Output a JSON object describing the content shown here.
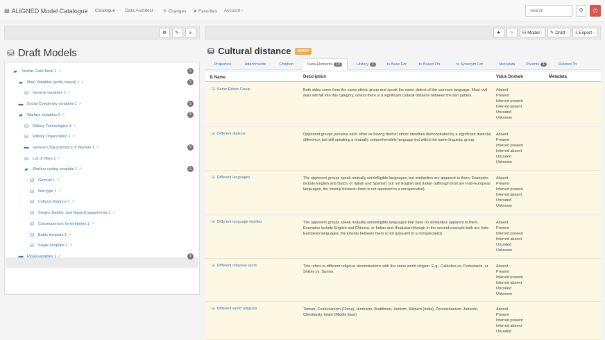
{
  "navbar": {
    "brand": "ALIGNED Model Catalogue",
    "links": [
      "Catalogue -",
      "Data Architect -",
      "Changes",
      "Favorites",
      "Account -"
    ],
    "search_placeholder": "Search"
  },
  "left": {
    "toolbar": {
      "settings": "⚙",
      "edit": "✎-",
      "download": "⤓-"
    },
    "title": "Draft Models",
    "tree": [
      {
        "label": "Seshat Code Book 1",
        "icon": "folder-open-icon",
        "badge": "5"
      },
      {
        "label": "Main Variables (polity-based) 1",
        "icon": "folder-open-icon",
        "badge": "5"
      },
      {
        "label": "General variables 1",
        "icon": "cubes-icon",
        "badge": ""
      },
      {
        "label": "Social Complexity variables 1",
        "icon": "folder-icon",
        "badge": "5"
      },
      {
        "label": "Warfare variables 1",
        "icon": "folder-open-icon",
        "badge": "5"
      },
      {
        "label": "Military Technologies 1",
        "icon": "cubes-icon",
        "badge": ""
      },
      {
        "label": "Military Organization 1",
        "icon": "cubes-icon",
        "badge": ""
      },
      {
        "label": "General Characteristics of Warfare 1",
        "icon": "folder-icon",
        "badge": "5"
      },
      {
        "label": "List of Wars 1",
        "icon": "cubes-icon",
        "badge": ""
      },
      {
        "label": "Warfare coding template 1",
        "icon": "folder-open-icon",
        "badge": "5"
      },
      {
        "label": "General 1",
        "icon": "cubes-icon",
        "badge": ""
      },
      {
        "label": "War type 1",
        "icon": "cubes-icon",
        "badge": ""
      },
      {
        "label": "Cultural distance 1",
        "icon": "cubes-icon",
        "badge": ""
      },
      {
        "label": "Sieges, Battles, and Naval Engagements 1",
        "icon": "cubes-icon",
        "badge": ""
      },
      {
        "label": "Consequences for territories 1",
        "icon": "cubes-icon",
        "badge": ""
      },
      {
        "label": "Battle template 1",
        "icon": "cubes-icon",
        "badge": ""
      },
      {
        "label": "Siege Template 1",
        "icon": "cubes-icon",
        "badge": ""
      },
      {
        "label": "Ritual variables 1",
        "icon": "folder-icon",
        "badge": "5"
      }
    ]
  },
  "right": {
    "toolbar": {
      "star": "★",
      "link": "☞",
      "model": "Model -",
      "draft": "Draft -",
      "export": "Export -"
    },
    "title": "Cultural distance",
    "status": "DRAFT",
    "tabs": [
      {
        "label": "Properties",
        "count": ""
      },
      {
        "label": "Attachments",
        "count": ""
      },
      {
        "label": "Children",
        "count": ""
      },
      {
        "label": "Data Elements",
        "count": "10"
      },
      {
        "label": "History",
        "count": "1"
      },
      {
        "label": "Is Base For",
        "count": ""
      },
      {
        "label": "Is Based On",
        "count": ""
      },
      {
        "label": "Is Synonym For",
        "count": ""
      },
      {
        "label": "Metadata",
        "count": ""
      },
      {
        "label": "Parents",
        "count": "1"
      },
      {
        "label": "Related To",
        "count": ""
      }
    ],
    "columns": {
      "name": "Name",
      "description": "Description",
      "value_domain": "Value Domain",
      "metadata": "Metadata"
    },
    "rows": [
      {
        "name": "Same Ethnic Group",
        "description": "Both sides come from the same ethnic group and speak the same dialect of the common language. Most civil wars will fall into this category, unless there is a significant cultural distance between the two parties.",
        "values": [
          "Absent",
          "Present",
          "Inferred present",
          "Inferred absent",
          "Uncoded",
          "Unknown"
        ]
      },
      {
        "name": "Different dialects",
        "description": "Opponent groups perceive each other as having distinct ethnic identities demonstrated by a significant dialectal difference, but still speaking a mutually comprehensible language but within the same linguistic group.",
        "values": [
          "Absent",
          "Present",
          "Inferred present",
          "Inferred absent",
          "Uncoded",
          "Unknown"
        ]
      },
      {
        "name": "Different languages",
        "description": "The opponent groups speak mutually unintelligible languages, but similarities are apparent to them. Examples include English and Dutch, or Italian and Spanish, but not English and Italian (although both are Indo-European languages, the kinship between them is not apparent to a nonspecialist).",
        "values": [
          "Absent",
          "Present",
          "Inferred present",
          "Inferred absent",
          "Uncoded",
          "Unknown"
        ]
      },
      {
        "name": "Different language families",
        "description": "The opponent groups speak mutually unintelligible languages that have no similarities apparent to them. Examples include English and Chinese, or Italian and Hindustani(though in the second example both are Indo-European languages, the kinship between them is not apparent to a nonspecialist).",
        "values": [
          "Absent",
          "Present",
          "Inferred present",
          "Inferred absent",
          "Uncoded",
          "Unknown"
        ]
      },
      {
        "name": "Different religious sects",
        "description": "This refers to different religious denominations with the same world religion. E.g., Catholics vs. Protestants, or Shiites vs. Sunnis.",
        "values": [
          "Absent",
          "Present",
          "Inferred present",
          "Inferred absent",
          "Uncoded",
          "Unknown"
        ]
      },
      {
        "name": "Different world religions",
        "description": "Taoism, Confucianism (China), Hinduism, Buddhism, Jainism, Sikhism (India), Zoroastrianism, Judaism, Christianity, Islam (Middle East)",
        "values": [
          "Absent",
          "Present",
          "Inferred present",
          "Inferred absent",
          "Uncoded"
        ]
      }
    ]
  }
}
